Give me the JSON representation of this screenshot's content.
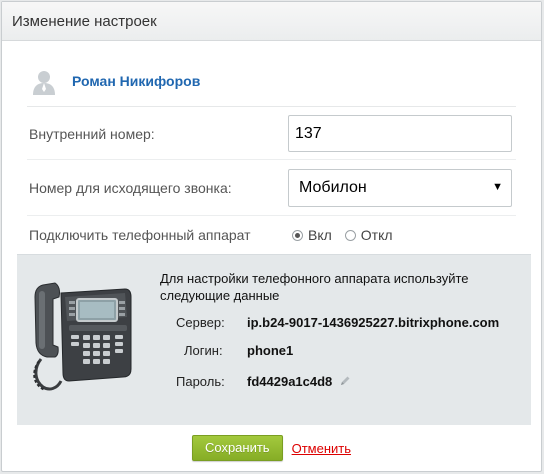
{
  "dialog": {
    "title": "Изменение настроек"
  },
  "user": {
    "name": "Роман Никифоров",
    "avatar_icon": "user-avatar-icon"
  },
  "form": {
    "extension": {
      "label": "Внутренний номер:",
      "value": "137"
    },
    "outgoing_number": {
      "label": "Номер для исходящего звонка:",
      "selected": "Мобилон"
    },
    "connect_phone": {
      "label": "Подключить телефонный аппарат",
      "options": [
        "Вкл",
        "Откл"
      ],
      "selected": "Вкл"
    }
  },
  "phone_info": {
    "description": "Для настройки телефонного аппарата используйте следующие данные",
    "server_label": "Сервер:",
    "server_value": "ip.b24-9017-1436925227.bitrixphone.com",
    "login_label": "Логин:",
    "login_value": "phone1",
    "password_label": "Пароль:",
    "password_value": "fd4429a1c4d8",
    "phone_icon": "desk-phone-icon",
    "edit_icon": "pencil-icon"
  },
  "footer": {
    "save_label": "Сохранить",
    "cancel_label": "Отменить"
  },
  "colors": {
    "accent_link": "#2067b0",
    "save_button": "#8fb82c",
    "cancel_link": "#dd0000"
  }
}
